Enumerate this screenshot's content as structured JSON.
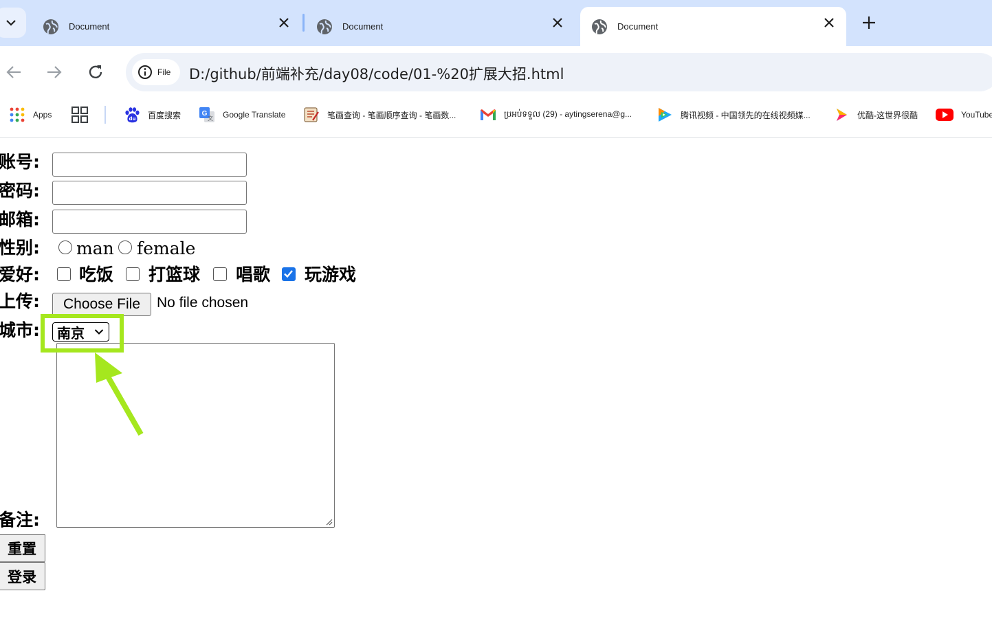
{
  "tabs": [
    {
      "title": "Document",
      "state": "inactive"
    },
    {
      "title": "Document",
      "state": "inactive"
    },
    {
      "title": "Document",
      "state": "active"
    }
  ],
  "address_bar": {
    "scheme_chip": "File",
    "url": "D:/github/前端补充/day08/code/01-%20扩展大招.html"
  },
  "bookmarks": [
    {
      "label": "Apps",
      "icon": "apps-grid-icon"
    },
    {
      "label": "",
      "icon": "tab-groups-icon"
    },
    {
      "label": "百度搜索",
      "icon": "baidu-paw-icon"
    },
    {
      "label": "Google Translate",
      "icon": "google-translate-icon"
    },
    {
      "label": "笔画查询 - 笔画顺序查询 - 笔画数...",
      "icon": "stroke-order-icon"
    },
    {
      "label": "ប្រអប់ទទួល (29) - aytingserena@g...",
      "icon": "gmail-icon"
    },
    {
      "label": "腾讯视频 - 中国领先的在线视频媒...",
      "icon": "tencent-video-icon"
    },
    {
      "label": "优酷-这世界很酷",
      "icon": "youku-icon"
    },
    {
      "label": "YouTube",
      "icon": "youtube-icon"
    }
  ],
  "form": {
    "account_label": "账号:",
    "password_label": "密码:",
    "email_label": "邮箱:",
    "gender_label": "性别:",
    "gender_options": [
      {
        "label": "man",
        "checked": false
      },
      {
        "label": "female",
        "checked": false
      }
    ],
    "hobby_label": "爱好:",
    "hobby_options": [
      {
        "label": "吃饭",
        "checked": false
      },
      {
        "label": "打篮球",
        "checked": false
      },
      {
        "label": "唱歌",
        "checked": false
      },
      {
        "label": "玩游戏",
        "checked": true
      }
    ],
    "upload_label": "上传:",
    "choose_file_button": "Choose File",
    "file_status": "No file chosen",
    "city_label": "城市:",
    "city_selected": "南京",
    "remark_label": "备注:",
    "reset_button": "重置",
    "login_button": "登录"
  },
  "annotation": {
    "highlight_color": "#a5e71e"
  },
  "colors": {
    "tabstrip_bg": "#d3e3fd",
    "checkbox_checked": "#1a73e8"
  }
}
